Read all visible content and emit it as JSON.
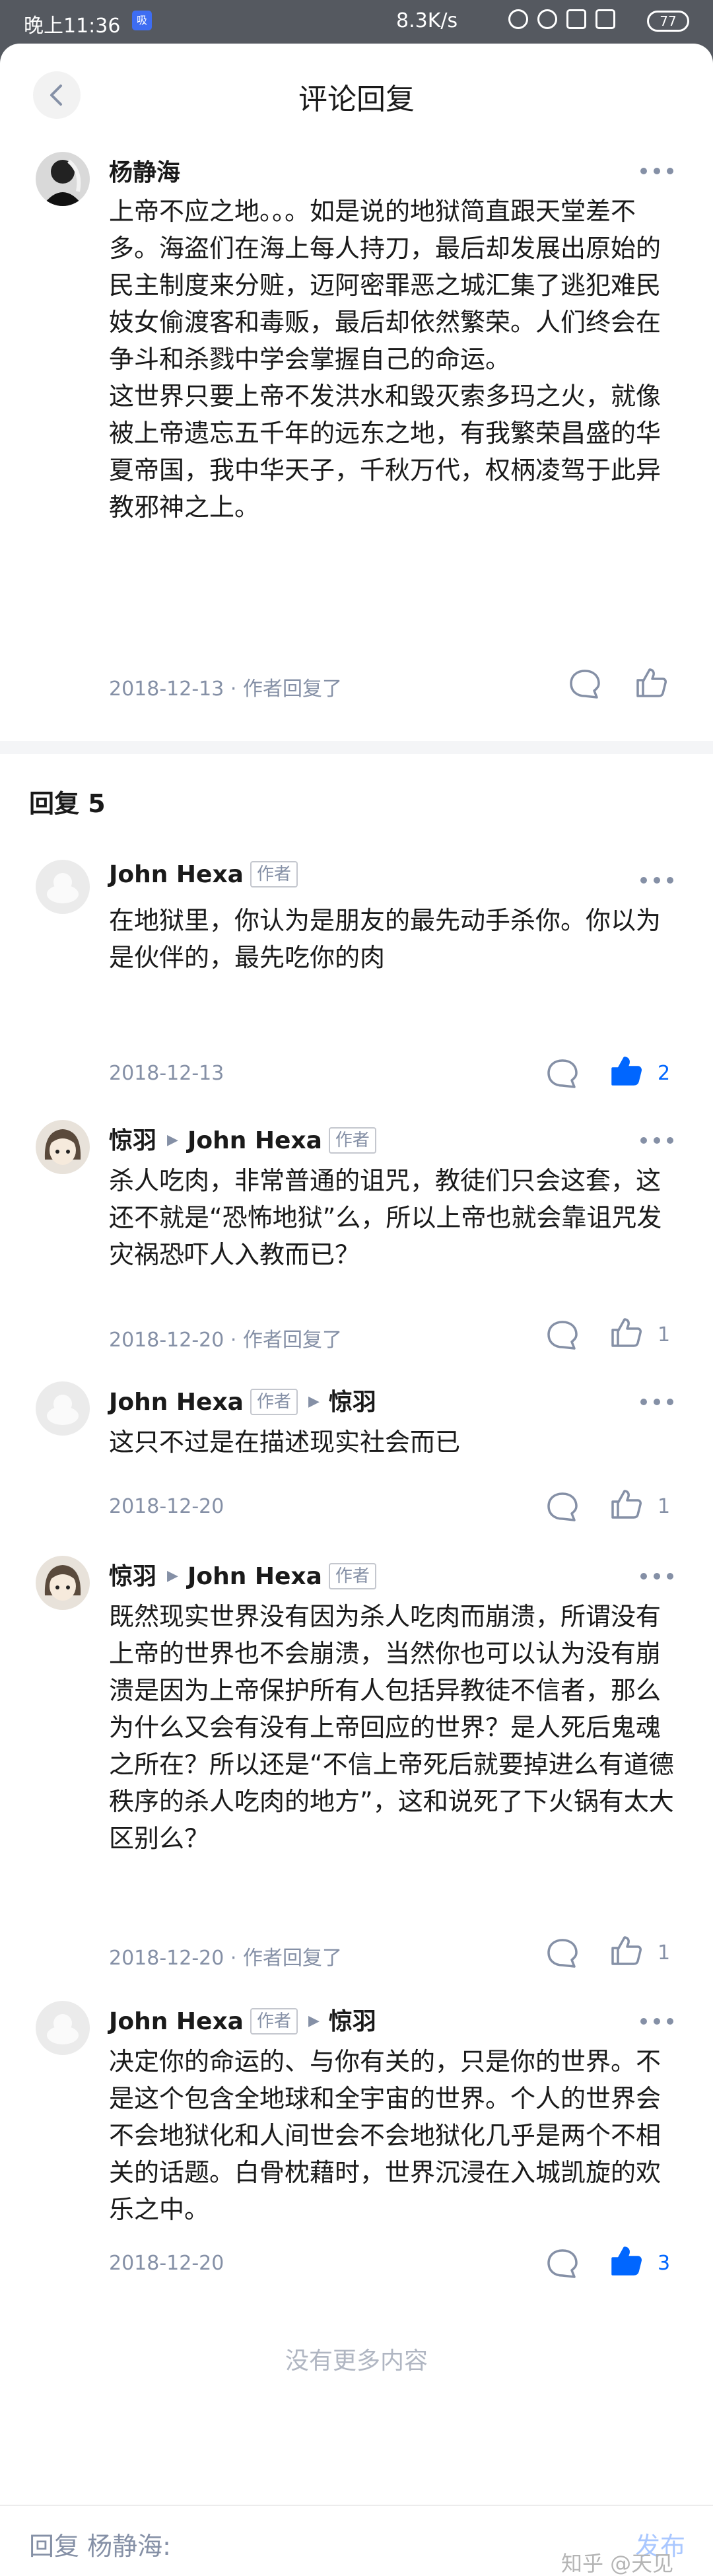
{
  "status_bar": {
    "time": "晚上11:36",
    "app_badge": "吸",
    "network_speed": "8.3K/s",
    "battery": "77"
  },
  "header": {
    "title": "评论回复"
  },
  "main_comment": {
    "author": "杨静海",
    "paragraphs": [
      "上帝不应之地。。。如是说的地狱简直跟天堂差不多。海盗们在海上每人持刀，最后却发展出原始的民主制度来分赃，迈阿密罪恶之城汇集了逃犯难民妓女偷渡客和毒贩，最后却依然繁荣。人们终会在争斗和杀戮中学会掌握自己的命运。",
      "这世界只要上帝不发洪水和毁灭索多玛之火，就像被上帝遗忘五千年的远东之地，有我繁荣昌盛的华夏帝国，我中华天子，千秋万代，权柄凌驾于此异教邪神之上。"
    ],
    "meta": "2018-12-13 · 作者回复了"
  },
  "replies_header": "回复 5",
  "replies": [
    {
      "author": "John Hexa",
      "author_tag": "作者",
      "reply_to": "",
      "reply_to_tag": "",
      "text": "在地狱里，你认为是朋友的最先动手杀你。你以为是伙伴的，最先吃你的肉",
      "meta": "2018-12-13",
      "likes": "2",
      "liked": true
    },
    {
      "author": "惊羽",
      "author_tag": "",
      "reply_to": "John Hexa",
      "reply_to_tag": "作者",
      "text": "杀人吃肉，非常普通的诅咒，教徒们只会这套，这还不就是“恐怖地狱”么，所以上帝也就会靠诅咒发灾祸恐吓人入教而已？",
      "meta": "2018-12-20 · 作者回复了",
      "likes": "1",
      "liked": false
    },
    {
      "author": "John Hexa",
      "author_tag": "作者",
      "reply_to": "惊羽",
      "reply_to_tag": "",
      "text": "这只不过是在描述现实社会而已",
      "meta": "2018-12-20",
      "likes": "1",
      "liked": false
    },
    {
      "author": "惊羽",
      "author_tag": "",
      "reply_to": "John Hexa",
      "reply_to_tag": "作者",
      "text": "既然现实世界没有因为杀人吃肉而崩溃，所谓没有上帝的世界也不会崩溃，当然你也可以认为没有崩溃是因为上帝保护所有人包括异教徒不信者，那么为什么又会有没有上帝回应的世界？是人死后鬼魂之所在？所以还是“不信上帝死后就要掉进么有道德秩序的杀人吃肉的地方”，这和说死了下火锅有太大区别么？",
      "meta": "2018-12-20 · 作者回复了",
      "likes": "1",
      "liked": false
    },
    {
      "author": "John Hexa",
      "author_tag": "作者",
      "reply_to": "惊羽",
      "reply_to_tag": "",
      "text": "决定你的命运的、与你有关的，只是你的世界。不是这个包含全地球和全宇宙的世界。个人的世界会不会地狱化和人间世会不会地狱化几乎是两个不相关的话题。白骨枕藉时，世界沉浸在入城凯旋的欢乐之中。",
      "meta": "2018-12-20",
      "likes": "3",
      "liked": true
    }
  ],
  "end_text": "没有更多内容",
  "bottom_bar": {
    "input_placeholder": "回复 杨静海:",
    "send_label": "发布",
    "watermark": "知乎 @天见"
  },
  "colors": {
    "accent": "#0066ff",
    "muted": "#8590a6",
    "background": "#ffffff"
  },
  "icons": [
    "back-icon",
    "more-icon",
    "comment-icon",
    "like-icon"
  ]
}
